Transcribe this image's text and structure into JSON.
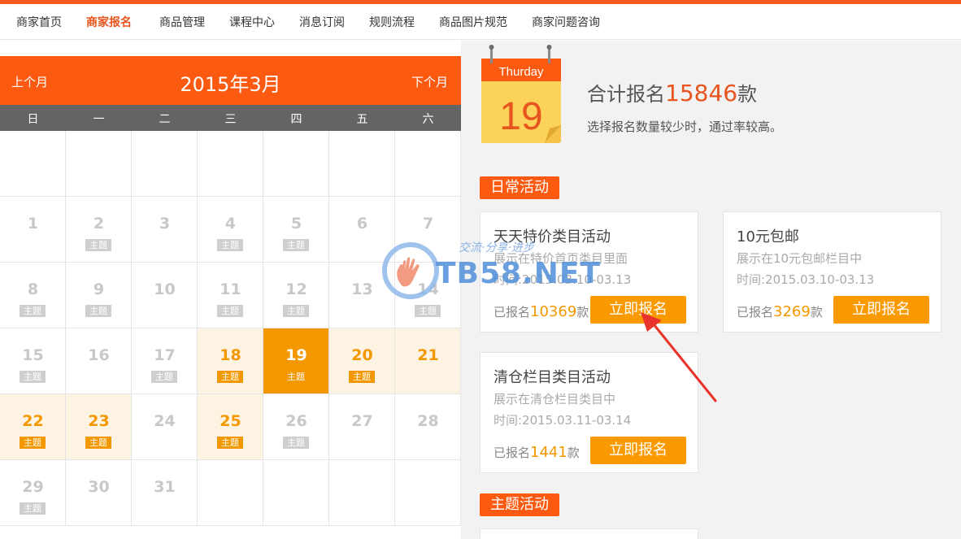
{
  "nav": {
    "items": [
      {
        "label": "商家首页",
        "active": false
      },
      {
        "label": "商家报名",
        "active": true
      },
      {
        "label": "商品管理",
        "active": false
      },
      {
        "label": "课程中心",
        "active": false
      },
      {
        "label": "消息订阅",
        "active": false
      },
      {
        "label": "规则流程",
        "active": false
      },
      {
        "label": "商品图片规范",
        "active": false
      },
      {
        "label": "商家问题咨询",
        "active": false
      }
    ]
  },
  "calendar": {
    "prev_label": "上个月",
    "next_label": "下个月",
    "title": "2015年3月",
    "weekdays": [
      "日",
      "一",
      "二",
      "三",
      "四",
      "五",
      "六"
    ],
    "tag_label": "主题",
    "weeks": [
      [
        null,
        null,
        null,
        null,
        null,
        null,
        null
      ],
      [
        {
          "day": "1",
          "tag": false
        },
        {
          "day": "2",
          "tag": true
        },
        {
          "day": "3",
          "tag": false
        },
        {
          "day": "4",
          "tag": true
        },
        {
          "day": "5",
          "tag": true
        },
        {
          "day": "6",
          "tag": false
        },
        {
          "day": "7",
          "tag": false
        }
      ],
      [
        {
          "day": "8",
          "tag": true
        },
        {
          "day": "9",
          "tag": true
        },
        {
          "day": "10",
          "tag": false
        },
        {
          "day": "11",
          "tag": true
        },
        {
          "day": "12",
          "tag": true
        },
        {
          "day": "13",
          "tag": false
        },
        {
          "day": "14",
          "tag": true
        }
      ],
      [
        {
          "day": "15",
          "tag": true
        },
        {
          "day": "16",
          "tag": false
        },
        {
          "day": "17",
          "tag": true
        },
        {
          "day": "18",
          "tag": true,
          "state": "hl"
        },
        {
          "day": "19",
          "tag": true,
          "state": "today"
        },
        {
          "day": "20",
          "tag": true,
          "state": "hl"
        },
        {
          "day": "21",
          "tag": false,
          "state": "hl"
        }
      ],
      [
        {
          "day": "22",
          "tag": true,
          "state": "hl"
        },
        {
          "day": "23",
          "tag": true,
          "state": "hl"
        },
        {
          "day": "24",
          "tag": false
        },
        {
          "day": "25",
          "tag": true,
          "state": "hl"
        },
        {
          "day": "26",
          "tag": true
        },
        {
          "day": "27",
          "tag": false
        },
        {
          "day": "28",
          "tag": false
        }
      ],
      [
        {
          "day": "29",
          "tag": true
        },
        {
          "day": "30",
          "tag": false
        },
        {
          "day": "31",
          "tag": false
        },
        null,
        null,
        null,
        null
      ]
    ]
  },
  "today_icon": {
    "weekday": "Thurday",
    "day": "19"
  },
  "summary": {
    "prefix": "合计报名",
    "count": "15846",
    "suffix": "款",
    "desc": "选择报名数量较少时，通过率较高。"
  },
  "sections": {
    "daily": "日常活动",
    "theme": "主题活动"
  },
  "cards": [
    {
      "title": "天天特价类目活动",
      "desc": "展示在特价首页类目里面",
      "time": "时间:2015.03.10-03.13",
      "count_prefix": "已报名",
      "count": "10369",
      "count_suffix": "款",
      "button": "立即报名"
    },
    {
      "title": "10元包邮",
      "desc": "展示在10元包邮栏目中",
      "time": "时间:2015.03.10-03.13",
      "count_prefix": "已报名",
      "count": "3269",
      "count_suffix": "款",
      "button": "立即报名"
    },
    {
      "title": "清仓栏目类目活动",
      "desc": "展示在清仓栏目类目中",
      "time": "时间:2015.03.11-03.14",
      "count_prefix": "已报名",
      "count": "1441",
      "count_suffix": "款",
      "button": "立即报名"
    }
  ],
  "watermark": {
    "text": "TB58.NET",
    "slogan": "交流·分享·进步"
  },
  "colors": {
    "brand": "#fb5a10",
    "accent": "#f39800",
    "highlight_bg": "#fdf3e3"
  }
}
